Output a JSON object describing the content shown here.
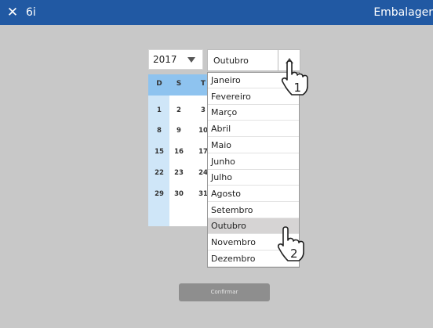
{
  "titlebar": {
    "close_glyph": "✕",
    "app_name": "6i",
    "title": "Embalager"
  },
  "year_select": {
    "value": "2017"
  },
  "calendar": {
    "weekday_headers": [
      "D",
      "S",
      "T"
    ],
    "weeks": [
      [
        "1",
        "2",
        "3"
      ],
      [
        "8",
        "9",
        "10"
      ],
      [
        "15",
        "16",
        "17"
      ],
      [
        "22",
        "23",
        "24"
      ],
      [
        "29",
        "30",
        "31"
      ]
    ]
  },
  "month_select": {
    "value": "Outubro",
    "options": [
      "Janeiro",
      "Fevereiro",
      "Março",
      "Abril",
      "Maio",
      "Junho",
      "Julho",
      "Agosto",
      "Setembro",
      "Outubro",
      "Novembro",
      "Dezembro"
    ],
    "selected_index": 9
  },
  "confirm_button": {
    "label": "Confirmar"
  },
  "annotations": {
    "step1": "1",
    "step2": "2"
  },
  "colors": {
    "titlebar": "#2159a3",
    "background": "#c8c8c8",
    "calendar_header": "#8ec3ef",
    "sunday_column": "#cfe6f8",
    "selected_option": "#d6d4d4",
    "button": "#8e8e8e"
  }
}
